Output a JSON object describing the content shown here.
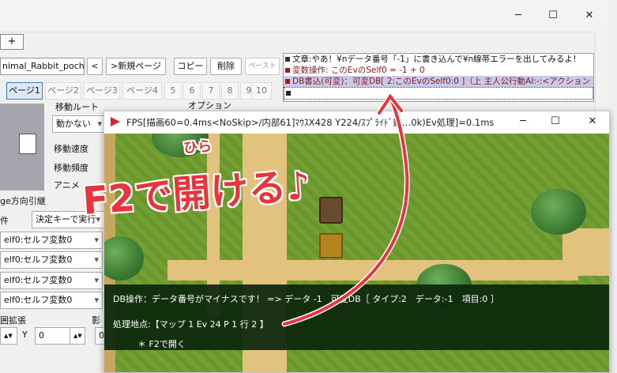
{
  "editor": {
    "window_buttons": {
      "minimize": "─",
      "maximize": "☐",
      "close": "✕"
    },
    "tab_add_label": "+",
    "event_name": "nimal_Rabbit_poch",
    "nav_prev": "<",
    "new_page": ">新規ページ",
    "copy": "コピー",
    "delete": "削除",
    "paste": "ペースト",
    "pages": [
      "ページ1",
      "ページ2",
      "ページ3",
      "ページ4",
      "5",
      "6",
      "7",
      "8",
      "9",
      "10"
    ],
    "move_route_label": "移動ルート",
    "move_route_value": "動かない",
    "options_label": "オプション",
    "move_speed_label": "移動速度",
    "move_freq_label": "移動頻度",
    "anime_label": "アニメ",
    "dir_inherit_label": "ge方向引継",
    "condition_label": "件",
    "trigger_value": "決定キーで実行",
    "self_vars": [
      "elf0:セルフ変数0",
      "elf0:セルフ変数0",
      "elf0:セルフ変数0",
      "elf0:セルフ変数0"
    ],
    "expand_label": "囲拡張",
    "shadow_label": "影",
    "y_label": "Y",
    "x_value": "0",
    "y_value": "0",
    "stepper_label": "▲▼"
  },
  "log": {
    "lines": [
      {
        "text": "文章:やあ！¥nデータ番号「-1」に書き込んで¥n線帯エラーを出してみるよ！",
        "mark": "#333333"
      },
      {
        "text": "変数操作: このEvのSelf0 = -1 + 0",
        "mark": "#9b1c1c"
      },
      {
        "text": "DB書込(可変)：可変DB[ 2:このEvのSelf0:0 ]（上 主人公行動AI:-:<アクション",
        "mark": "#9b1c1c"
      },
      {
        "text": "",
        "mark": "#222222"
      }
    ]
  },
  "game": {
    "title": "FPS[描画60=0.4ms<NoSkip>/内部61]ﾏｳｽX428 Y224/ｽﾌﾟﾗｲﾄﾞ数…0k)Ev処理]=0.1ms",
    "window_buttons": {
      "minimize": "─",
      "maximize": "☐",
      "close": "✕"
    },
    "error_line1": "DB操作：データ番号がマイナスです！ => データ -1　可変DB［ タイプ:2　データ:-1　項目:0 ］",
    "error_line2": "処理地点:【マップ 1 Ev 24 P 1 行 2 】",
    "error_line3": "＊ F2で開く"
  },
  "annotation": {
    "text_main": "F2で開ける♪",
    "furigana": "ひら",
    "color": "#e8343c"
  }
}
